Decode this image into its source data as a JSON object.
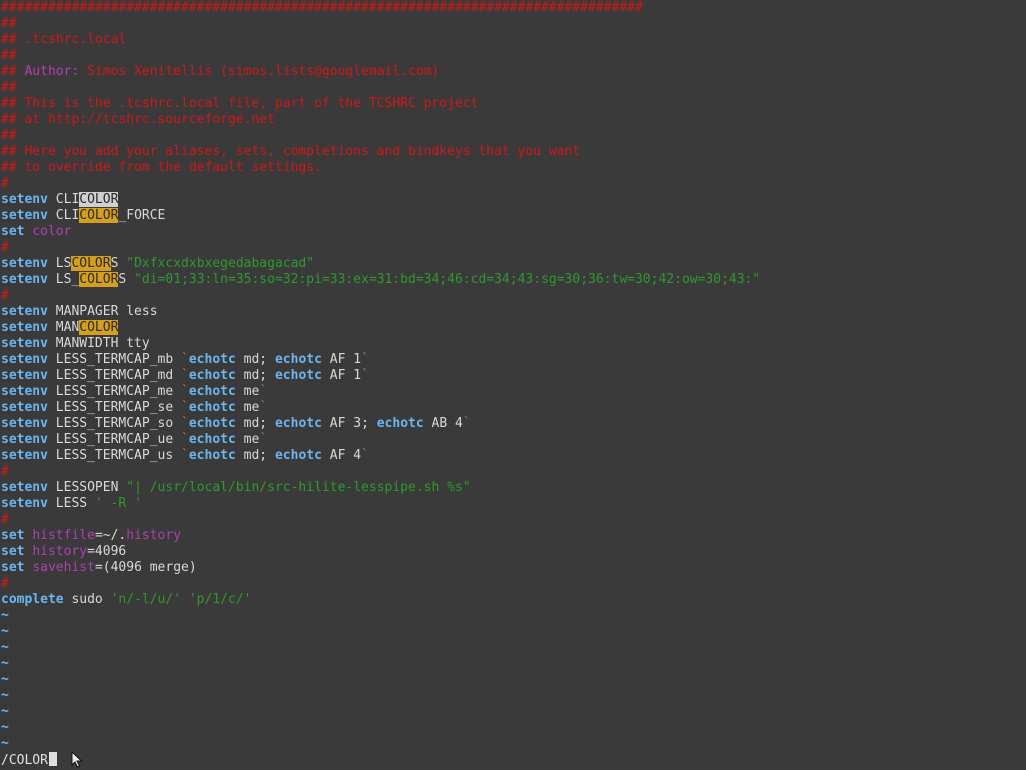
{
  "editor": {
    "lines": [
      [
        {
          "t": "##################################################################################",
          "c": "c"
        }
      ],
      [
        {
          "t": "##",
          "c": "c"
        }
      ],
      [
        {
          "t": "## .tcshrc.local",
          "c": "c"
        }
      ],
      [
        {
          "t": "##",
          "c": "c"
        }
      ],
      [
        {
          "t": "## ",
          "c": "c"
        },
        {
          "t": "Author:",
          "c": "ca"
        },
        {
          "t": " Simos Xenitellis (simos.lists@googlemail.com)",
          "c": "c"
        }
      ],
      [
        {
          "t": "##",
          "c": "c"
        }
      ],
      [
        {
          "t": "## This is the .tcshrc.local file, part of the TCSHRC project",
          "c": "c"
        }
      ],
      [
        {
          "t": "## at http://tcshrc.sourceforge.net",
          "c": "c"
        }
      ],
      [
        {
          "t": "##",
          "c": "c"
        }
      ],
      [
        {
          "t": "## Here you add your aliases, sets, completions and bindkeys that you want",
          "c": "c"
        }
      ],
      [
        {
          "t": "## to override from the default settings.",
          "c": "c"
        }
      ],
      [
        {
          "t": "#",
          "c": "c"
        }
      ],
      [
        {
          "t": "setenv",
          "c": "k"
        },
        {
          "t": " CLI",
          "c": "t"
        },
        {
          "t": "COLOR",
          "c": "hc"
        }
      ],
      [
        {
          "t": "setenv",
          "c": "k"
        },
        {
          "t": " CLI",
          "c": "t"
        },
        {
          "t": "COLOR",
          "c": "h"
        },
        {
          "t": "_FORCE",
          "c": "t"
        }
      ],
      [
        {
          "t": "set",
          "c": "k"
        },
        {
          "t": " ",
          "c": "t"
        },
        {
          "t": "color",
          "c": "v"
        }
      ],
      [
        {
          "t": "#",
          "c": "c"
        }
      ],
      [
        {
          "t": "setenv",
          "c": "k"
        },
        {
          "t": " LS",
          "c": "t"
        },
        {
          "t": "COLOR",
          "c": "h"
        },
        {
          "t": "S ",
          "c": "t"
        },
        {
          "t": "\"Dxfxcxdxbxegedabagacad\"",
          "c": "s"
        }
      ],
      [
        {
          "t": "setenv",
          "c": "k"
        },
        {
          "t": " LS_",
          "c": "t"
        },
        {
          "t": "COLOR",
          "c": "h"
        },
        {
          "t": "S ",
          "c": "t"
        },
        {
          "t": "\"di=01;33:ln=35:so=32:pi=33:ex=31:bd=34;46:cd=34;43:sg=30;36:tw=30;42:ow=30;43:\"",
          "c": "s"
        }
      ],
      [
        {
          "t": "#",
          "c": "c"
        }
      ],
      [
        {
          "t": "setenv",
          "c": "k"
        },
        {
          "t": " MANPAGER less",
          "c": "t"
        }
      ],
      [
        {
          "t": "setenv",
          "c": "k"
        },
        {
          "t": " MAN",
          "c": "t"
        },
        {
          "t": "COLOR",
          "c": "h"
        }
      ],
      [
        {
          "t": "setenv",
          "c": "k"
        },
        {
          "t": " MANWIDTH tty",
          "c": "t"
        }
      ],
      [
        {
          "t": "setenv",
          "c": "k"
        },
        {
          "t": " LESS_TERMCAP_mb ",
          "c": "t"
        },
        {
          "t": "`",
          "c": "q"
        },
        {
          "t": "echotc",
          "c": "k"
        },
        {
          "t": " md; ",
          "c": "t"
        },
        {
          "t": "echotc",
          "c": "k"
        },
        {
          "t": " AF 1",
          "c": "t"
        },
        {
          "t": "`",
          "c": "q"
        }
      ],
      [
        {
          "t": "setenv",
          "c": "k"
        },
        {
          "t": " LESS_TERMCAP_md ",
          "c": "t"
        },
        {
          "t": "`",
          "c": "q"
        },
        {
          "t": "echotc",
          "c": "k"
        },
        {
          "t": " md; ",
          "c": "t"
        },
        {
          "t": "echotc",
          "c": "k"
        },
        {
          "t": " AF 1",
          "c": "t"
        },
        {
          "t": "`",
          "c": "q"
        }
      ],
      [
        {
          "t": "setenv",
          "c": "k"
        },
        {
          "t": " LESS_TERMCAP_me ",
          "c": "t"
        },
        {
          "t": "`",
          "c": "q"
        },
        {
          "t": "echotc",
          "c": "k"
        },
        {
          "t": " me",
          "c": "t"
        },
        {
          "t": "`",
          "c": "q"
        }
      ],
      [
        {
          "t": "setenv",
          "c": "k"
        },
        {
          "t": " LESS_TERMCAP_se ",
          "c": "t"
        },
        {
          "t": "`",
          "c": "q"
        },
        {
          "t": "echotc",
          "c": "k"
        },
        {
          "t": " me",
          "c": "t"
        },
        {
          "t": "`",
          "c": "q"
        }
      ],
      [
        {
          "t": "setenv",
          "c": "k"
        },
        {
          "t": " LESS_TERMCAP_so ",
          "c": "t"
        },
        {
          "t": "`",
          "c": "q"
        },
        {
          "t": "echotc",
          "c": "k"
        },
        {
          "t": " md; ",
          "c": "t"
        },
        {
          "t": "echotc",
          "c": "k"
        },
        {
          "t": " AF 3; ",
          "c": "t"
        },
        {
          "t": "echotc",
          "c": "k"
        },
        {
          "t": " AB 4",
          "c": "t"
        },
        {
          "t": "`",
          "c": "q"
        }
      ],
      [
        {
          "t": "setenv",
          "c": "k"
        },
        {
          "t": " LESS_TERMCAP_ue ",
          "c": "t"
        },
        {
          "t": "`",
          "c": "q"
        },
        {
          "t": "echotc",
          "c": "k"
        },
        {
          "t": " me",
          "c": "t"
        },
        {
          "t": "`",
          "c": "q"
        }
      ],
      [
        {
          "t": "setenv",
          "c": "k"
        },
        {
          "t": " LESS_TERMCAP_us ",
          "c": "t"
        },
        {
          "t": "`",
          "c": "q"
        },
        {
          "t": "echotc",
          "c": "k"
        },
        {
          "t": " md; ",
          "c": "t"
        },
        {
          "t": "echotc",
          "c": "k"
        },
        {
          "t": " AF 4",
          "c": "t"
        },
        {
          "t": "`",
          "c": "q"
        }
      ],
      [
        {
          "t": "#",
          "c": "c"
        }
      ],
      [
        {
          "t": "setenv",
          "c": "k"
        },
        {
          "t": " LESSOPEN ",
          "c": "t"
        },
        {
          "t": "\"| /usr/local/bin/src-hilite-lesspipe.sh %s\"",
          "c": "s"
        }
      ],
      [
        {
          "t": "setenv",
          "c": "k"
        },
        {
          "t": " LESS ",
          "c": "t"
        },
        {
          "t": "' -R '",
          "c": "s"
        }
      ],
      [
        {
          "t": "#",
          "c": "c"
        }
      ],
      [
        {
          "t": "set",
          "c": "k"
        },
        {
          "t": " ",
          "c": "t"
        },
        {
          "t": "histfile",
          "c": "v"
        },
        {
          "t": "=~/.",
          "c": "t"
        },
        {
          "t": "history",
          "c": "v"
        }
      ],
      [
        {
          "t": "set",
          "c": "k"
        },
        {
          "t": " ",
          "c": "t"
        },
        {
          "t": "history",
          "c": "v"
        },
        {
          "t": "=4096",
          "c": "t"
        }
      ],
      [
        {
          "t": "set",
          "c": "k"
        },
        {
          "t": " ",
          "c": "t"
        },
        {
          "t": "savehist",
          "c": "v"
        },
        {
          "t": "=(4096 merge)",
          "c": "t"
        }
      ],
      [
        {
          "t": "#",
          "c": "c"
        }
      ],
      [
        {
          "t": "complete",
          "c": "k"
        },
        {
          "t": " sudo ",
          "c": "t"
        },
        {
          "t": "'n/-l/u/' 'p/1/c/'",
          "c": "s"
        }
      ],
      [
        {
          "t": "~",
          "c": "td"
        }
      ],
      [
        {
          "t": "~",
          "c": "td"
        }
      ],
      [
        {
          "t": "~",
          "c": "td"
        }
      ],
      [
        {
          "t": "~",
          "c": "td"
        }
      ],
      [
        {
          "t": "~",
          "c": "td"
        }
      ],
      [
        {
          "t": "~",
          "c": "td"
        }
      ],
      [
        {
          "t": "~",
          "c": "td"
        }
      ],
      [
        {
          "t": "~",
          "c": "td"
        }
      ],
      [
        {
          "t": "~",
          "c": "td"
        }
      ]
    ]
  },
  "command_line": {
    "text": "/COLOR"
  },
  "colors": {
    "background": "#3a3a3a",
    "comment": "#d01818",
    "keyword": "#6ab7f0",
    "variable": "#b040b0",
    "string": "#2e9a2e",
    "search_highlight": "#d4a017",
    "current_match": "#d0d0d0"
  },
  "icons": {
    "pointer": "mouse-pointer-icon"
  }
}
